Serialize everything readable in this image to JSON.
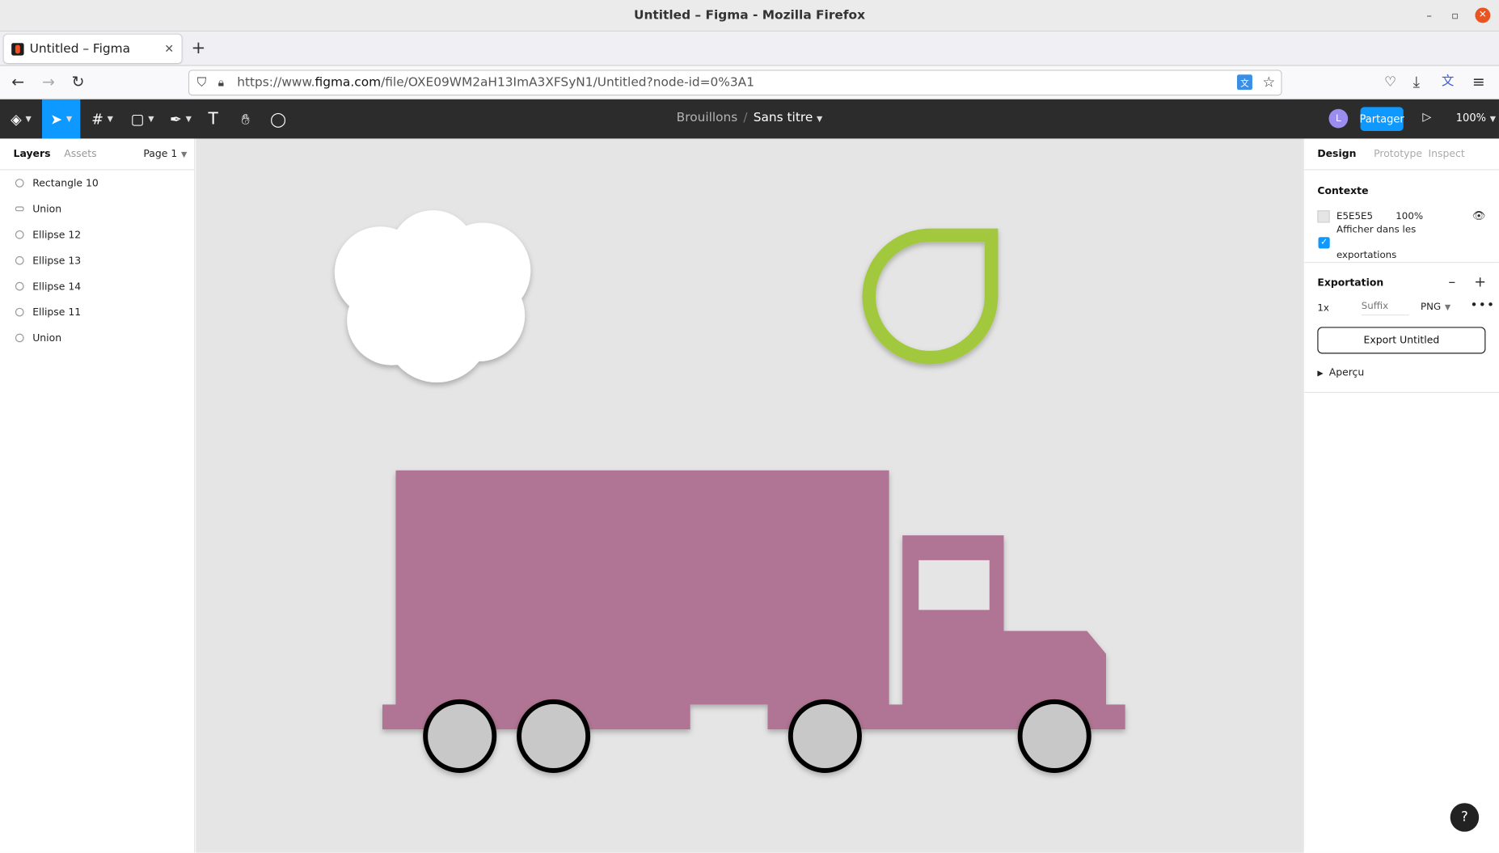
{
  "window": {
    "title": "Untitled – Figma - Mozilla Firefox"
  },
  "browser": {
    "tab_title": "Untitled – Figma",
    "url_prefix": "https://www.",
    "url_domain": "figma.com",
    "url_path": "/file/OXE09WM2aH13ImA3XFSyN1/Untitled?node-id=0%3A1"
  },
  "figma_toolbar": {
    "breadcrumb_folder": "Brouillons",
    "breadcrumb_sep": "/",
    "file_name": "Sans titre",
    "avatar_initial": "L",
    "share_label": "Partager",
    "zoom": "100%"
  },
  "left_panel": {
    "tab_layers": "Layers",
    "tab_assets": "Assets",
    "page": "Page 1",
    "layers": [
      "Rectangle 10",
      "Union",
      "Ellipse 12",
      "Ellipse 13",
      "Ellipse 14",
      "Ellipse 11",
      "Union"
    ]
  },
  "right_panel": {
    "tab_design": "Design",
    "tab_prototype": "Prototype",
    "tab_inspect": "Inspect",
    "context_title": "Contexte",
    "bg_color": "E5E5E5",
    "bg_opacity": "100%",
    "show_in_exports_1": "Afficher dans les",
    "show_in_exports_2": "exportations",
    "export_title": "Exportation",
    "export_scale": "1x",
    "suffix_placeholder": "Suffix",
    "format": "PNG",
    "export_button": "Export Untitled",
    "preview_label": "Aperçu"
  },
  "help": "?",
  "colors": {
    "accent": "#0d99ff",
    "toolbar_bg": "#2c2c2c",
    "canvas_bg": "#e5e5e5",
    "truck": "#b07594",
    "leaf": "#a2c93e",
    "wheel_fill": "#c8c8c8",
    "cloud": "#ffffff"
  }
}
